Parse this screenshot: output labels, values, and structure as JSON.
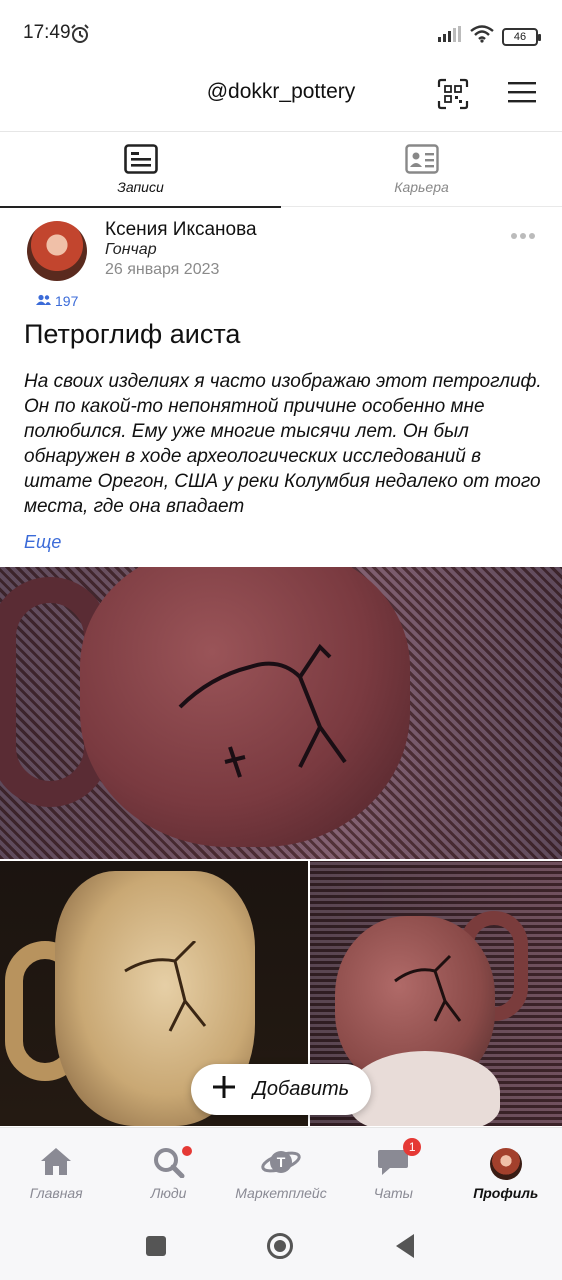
{
  "status_bar": {
    "time": "17:49",
    "battery": "46",
    "icons": [
      "alarm-icon",
      "signal-icon",
      "wifi-icon",
      "battery-icon"
    ]
  },
  "header": {
    "title": "@dokkr_pottery",
    "icons": [
      "qr-code-icon",
      "menu-icon"
    ]
  },
  "tabs": [
    {
      "label": "Записи",
      "icon": "posts-icon",
      "active": true
    },
    {
      "label": "Карьера",
      "icon": "career-card-icon",
      "active": false
    }
  ],
  "post": {
    "author": "Ксения Иксанова",
    "role": "Гончар",
    "date": "26 января 2023",
    "followers": "197",
    "title": "Петроглиф аиста",
    "text": "На своих изделиях я часто изображаю этот петроглиф. Он по какой-то непонятной причине особенно мне полюбился. Ему уже многие тысячи лет. Он был обнаружен в ходе археологических исследований в штате Орегон, США у реки Колумбия недалеко от того места, где она впадает",
    "more_label": "Еще"
  },
  "add_button": {
    "label": "Добавить"
  },
  "bottom_nav": [
    {
      "label": "Главная",
      "icon": "home-icon"
    },
    {
      "label": "Люди",
      "icon": "search-people-icon"
    },
    {
      "label": "Маркетплейс",
      "icon": "marketplace-icon"
    },
    {
      "label": "Чаты",
      "icon": "chat-icon",
      "badge": "1"
    },
    {
      "label": "Профиль",
      "icon": "profile-avatar",
      "active": true
    }
  ],
  "colors": {
    "accent": "#3b6bd8",
    "badge": "#e53935",
    "nav_inactive": "#8a8a94"
  }
}
